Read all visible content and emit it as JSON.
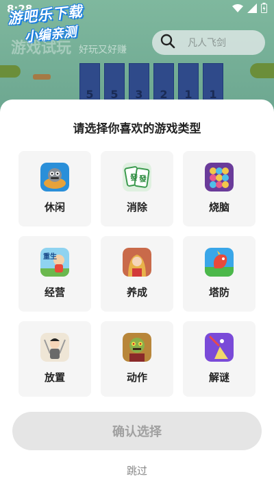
{
  "status_bar": {
    "time": "8:28"
  },
  "watermark": {
    "line1": "游吧乐下载",
    "line2": "小编亲测"
  },
  "background": {
    "logo": "游戏试玩",
    "slogan": "好玩又好赚",
    "search_placeholder": "凡人飞剑",
    "tiles": [
      "5",
      "5",
      "3",
      "2",
      "1",
      "1"
    ]
  },
  "sheet": {
    "title": "请选择你喜欢的游戏类型",
    "categories": [
      {
        "label": "休闲",
        "icon": "casual-game-icon"
      },
      {
        "label": "消除",
        "icon": "mahjong-tile-icon"
      },
      {
        "label": "烧脑",
        "icon": "puzzle-dots-icon"
      },
      {
        "label": "经营",
        "icon": "business-sim-icon"
      },
      {
        "label": "养成",
        "icon": "character-raising-icon"
      },
      {
        "label": "塔防",
        "icon": "tower-defense-icon"
      },
      {
        "label": "放置",
        "icon": "idle-game-icon"
      },
      {
        "label": "动作",
        "icon": "action-zombie-icon"
      },
      {
        "label": "解谜",
        "icon": "riddle-ball-icon"
      }
    ],
    "confirm_label": "确认选择",
    "skip_label": "跳过"
  },
  "colors": {
    "sheet_bg": "#ffffff",
    "card_bg": "#f5f5f5",
    "button_disabled_bg": "#e5e5e5",
    "button_disabled_text": "#a0a0a0"
  }
}
